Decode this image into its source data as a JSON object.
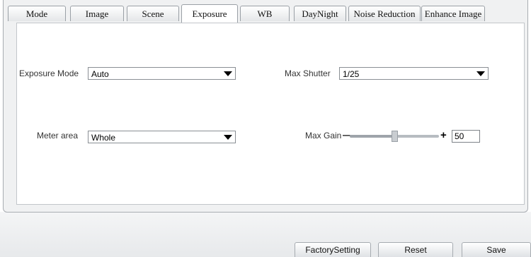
{
  "tabs": [
    {
      "label": "Mode"
    },
    {
      "label": "Image"
    },
    {
      "label": "Scene"
    },
    {
      "label": "Exposure",
      "active": true
    },
    {
      "label": "WB"
    },
    {
      "label": "DayNight"
    },
    {
      "label": "Noise Reduction"
    },
    {
      "label": "Enhance Image"
    }
  ],
  "form": {
    "exposure_mode": {
      "label": "Exposure Mode",
      "value": "Auto"
    },
    "max_shutter": {
      "label": "Max Shutter",
      "value": "1/25"
    },
    "meter_area": {
      "label": "Meter area",
      "value": "Whole"
    },
    "max_gain": {
      "label": "Max Gain",
      "minus": "—",
      "plus": "+",
      "value": "50",
      "fraction": 0.5
    }
  },
  "buttons": {
    "factory": "FactorySetting",
    "reset": "Reset",
    "save": "Save"
  },
  "colors": {
    "panel": "#f0f1f2",
    "border": "#a9adb2"
  }
}
